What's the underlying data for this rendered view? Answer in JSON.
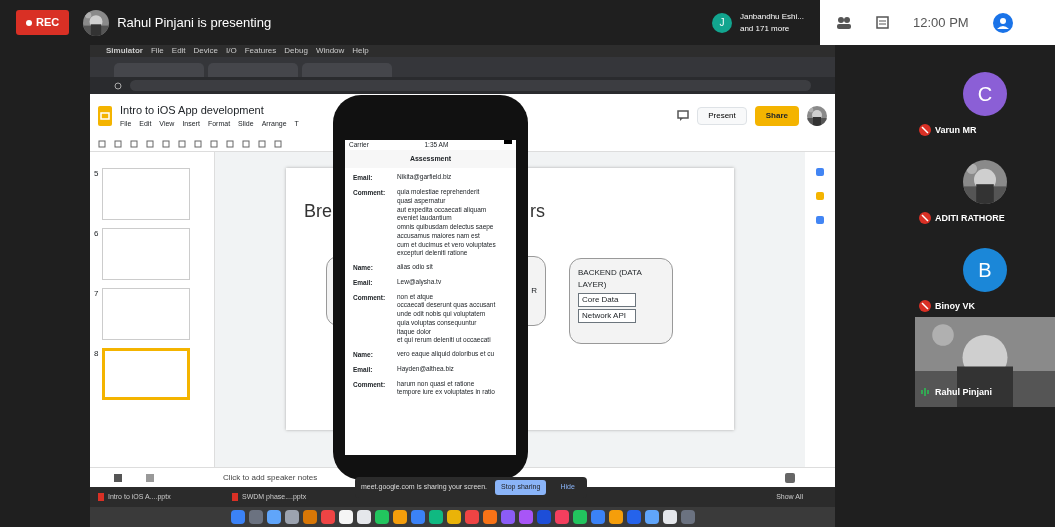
{
  "meeting": {
    "rec_label": "REC",
    "presenter_text": "Rahul Pinjani is presenting",
    "participant_avatar": "J",
    "participant_name": "Janbandhu Eshi...",
    "participant_more": "and 171 more",
    "time": "12:00 PM"
  },
  "mac_menu": [
    "Simulator",
    "File",
    "Edit",
    "Device",
    "I/O",
    "Features",
    "Debug",
    "Window",
    "Help"
  ],
  "slides_doc": {
    "title": "Intro to iOS App development",
    "menu": [
      "File",
      "Edit",
      "View",
      "Insert",
      "Format",
      "Slide",
      "Arrange",
      "T"
    ],
    "present_button": "Present",
    "share_button": "Share",
    "thumbnails": [
      {
        "number": "5",
        "selected": false
      },
      {
        "number": "6",
        "selected": false
      },
      {
        "number": "7",
        "selected": false
      },
      {
        "number": "8",
        "selected": true
      }
    ],
    "slide": {
      "title_left": "Bre",
      "title_right": "rs",
      "middle_box_text": "R",
      "backend_title": "BACKEND (DATA LAYER)",
      "backend_items": [
        "Core Data",
        "Network API"
      ]
    },
    "speaker_notes_placeholder": "Click to add speaker notes"
  },
  "simulator": {
    "carrier": "Carrier",
    "time": "1:35 AM",
    "title": "Assessment",
    "rows": [
      {
        "label": "Email:",
        "value": "Nikita@garfield.biz"
      },
      {
        "label": "Comment:",
        "value": "quia molestiae reprehenderit\nquasi aspernatur\naut expedita occaecati aliquam\neveniet laudantium\nomnis quibusdam delectus saepe\naccusamus maiores nam est\ncum et ducimus et vero voluptates\nexcepturi deleniti ratione"
      },
      {
        "label": "Name:",
        "value": "alias odio sit"
      },
      {
        "label": "Email:",
        "value": "Lew@alysha.tv"
      },
      {
        "label": "Comment:",
        "value": "non et atque\noccaecati deserunt quas accusant\nunde odit nobis qui voluptatem\nquia voluptas consequuntur\nitaque dolor\net qui rerum deleniti ut occaecati"
      },
      {
        "label": "Name:",
        "value": "vero eaque aliquid doloribus et cu"
      },
      {
        "label": "Email:",
        "value": "Hayden@althea.biz"
      },
      {
        "label": "Comment:",
        "value": "harum non quasi et ratione\ntempore iure ex voluptates in ratio"
      }
    ]
  },
  "sharing_bar": {
    "message": "meet.google.com is sharing your screen.",
    "stop_button": "Stop sharing",
    "hide_button": "Hide"
  },
  "downloads": [
    "Intro to iOS A....pptx",
    "SWDM phase....pptx"
  ],
  "show_all": "Show All",
  "participants": [
    {
      "name": "Varun MR",
      "kind": "letter",
      "avatar": "C",
      "color": "#8b5fd6",
      "muted": true
    },
    {
      "name": "ADITI RATHORE",
      "kind": "picture",
      "muted": true
    },
    {
      "name": "Binoy VK",
      "kind": "letter",
      "avatar": "B",
      "color": "#1b87d8",
      "muted": true
    },
    {
      "name": "Rahul Pinjani",
      "kind": "video",
      "muted": false
    }
  ]
}
